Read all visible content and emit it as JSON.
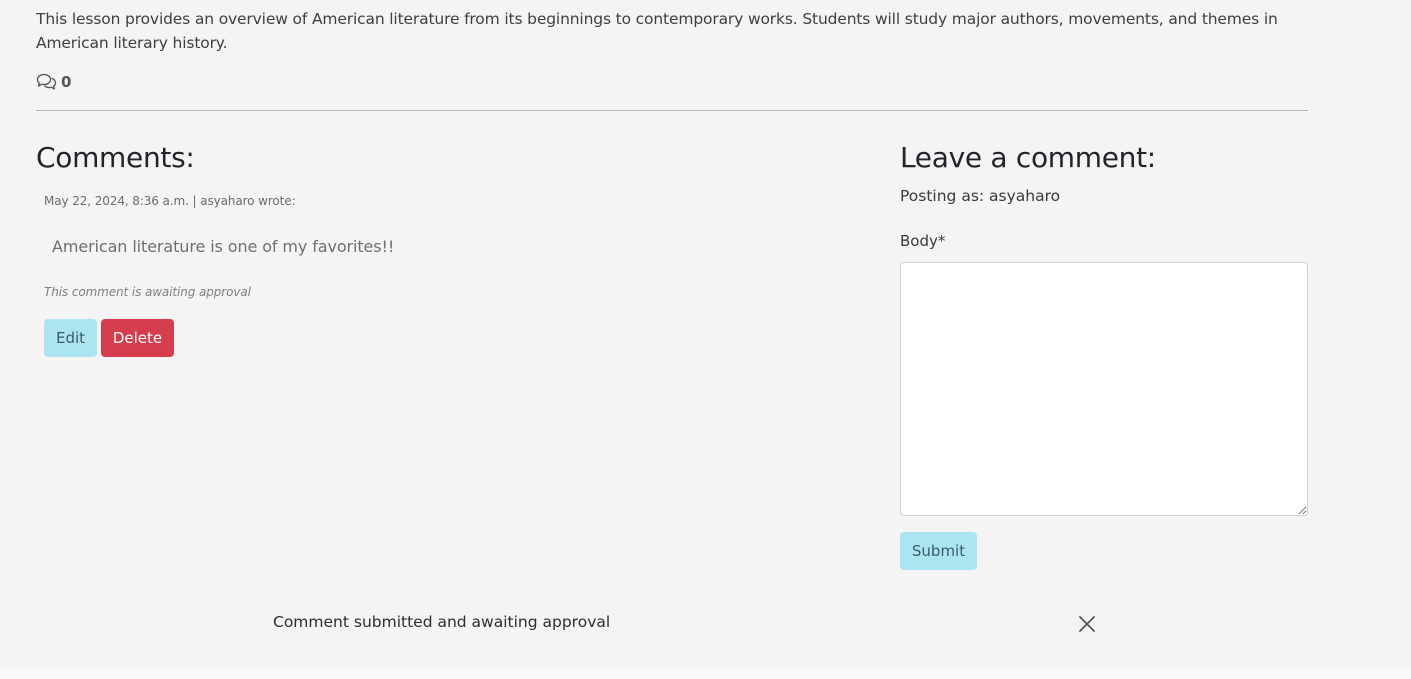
{
  "lesson": {
    "description": "This lesson provides an overview of American literature from its beginnings to contemporary works. Students will study major authors, movements, and themes in American literary history.",
    "comment_count": "0",
    "comment_icon": "comments-icon"
  },
  "comments": {
    "heading": "Comments:",
    "items": [
      {
        "meta": "May 22, 2024, 8:36 a.m. | asyaharo wrote:",
        "body": "American literature is one of my favorites!!",
        "status": "This comment is awaiting approval",
        "edit_label": "Edit",
        "delete_label": "Delete"
      }
    ]
  },
  "form": {
    "heading": "Leave a comment:",
    "posting_as": "Posting as: asyaharo",
    "body_label": "Body*",
    "body_value": "",
    "submit_label": "Submit"
  },
  "toast": {
    "message": "Comment submitted and awaiting approval",
    "close_icon": "close-icon"
  },
  "colors": {
    "info_button": "#abe5f2",
    "danger_button": "#d43d4b",
    "page_background": "#f4f4f4"
  }
}
